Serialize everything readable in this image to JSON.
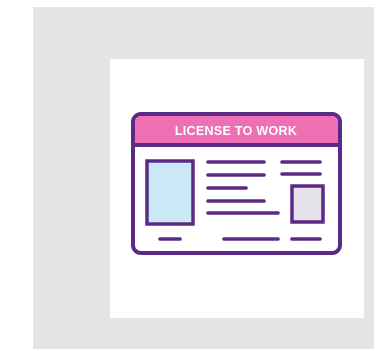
{
  "icon": {
    "name": "work-license-card-icon",
    "banner_text": "LICENSE TO WORK",
    "colors": {
      "outline": "#5b2a86",
      "banner": "#ee6fb4",
      "photo": "#cbe9f7",
      "thumb": "#e6e3ea",
      "frame_bg": "#e5e5e5",
      "canvas_bg": "#ffffff"
    }
  }
}
